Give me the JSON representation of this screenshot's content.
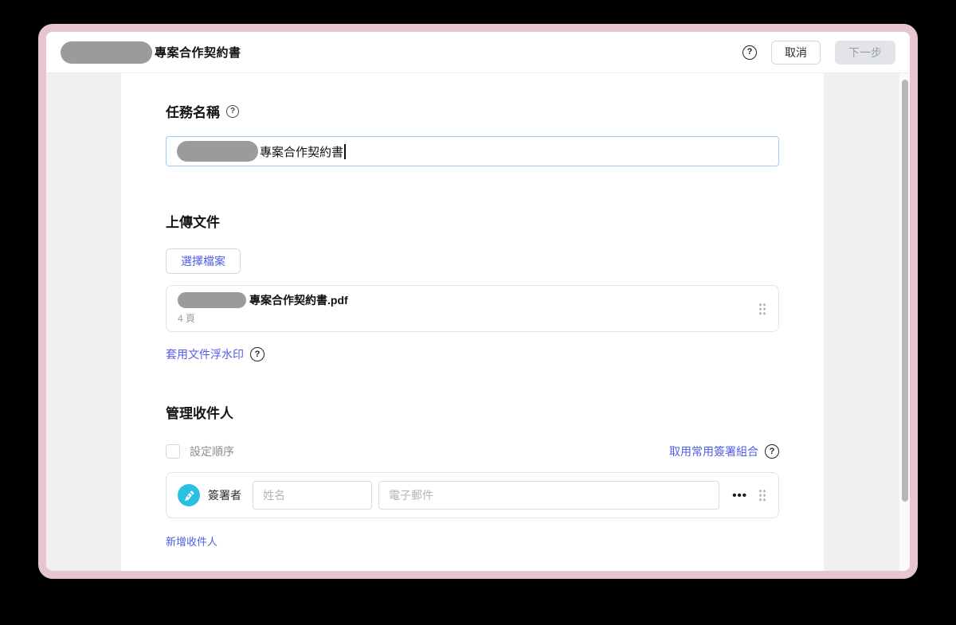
{
  "topbar": {
    "title": "專案合作契約書",
    "help_icon": "?",
    "cancel_label": "取消",
    "next_label": "下一步"
  },
  "task_name": {
    "heading": "任務名稱",
    "help_icon": "?",
    "value": "專案合作契約書"
  },
  "upload": {
    "heading": "上傳文件",
    "choose_file_label": "選擇檔案",
    "file": {
      "name": "專案合作契約書.pdf",
      "pages": "4 頁"
    },
    "watermark_link": "套用文件浮水印",
    "watermark_help_icon": "?"
  },
  "recipients": {
    "heading": "管理收件人",
    "set_order_label": "設定順序",
    "preset_link": "取用常用簽署組合",
    "preset_help_icon": "?",
    "row": {
      "role": "簽署者",
      "name_placeholder": "姓名",
      "email_placeholder": "電子郵件",
      "more_label": "•••"
    },
    "add_link": "新增收件人"
  },
  "colors": {
    "accent_blue": "#515ce6",
    "signer_cyan": "#2bbfe2",
    "frame_pink": "#e6c5d0",
    "next_disabled_bg": "#e2e4e9"
  }
}
